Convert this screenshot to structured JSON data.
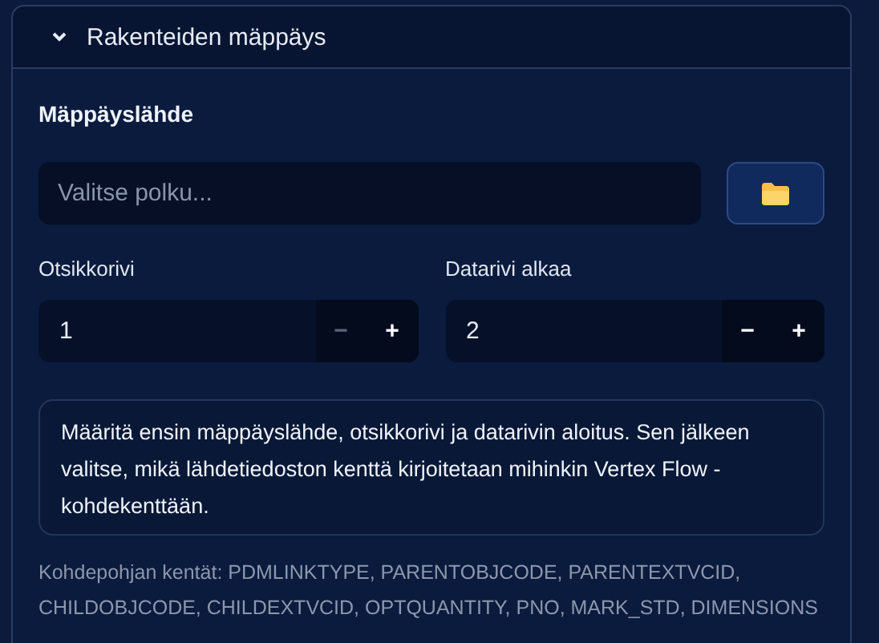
{
  "section": {
    "title": "Rakenteiden mäppäys",
    "expanded": true
  },
  "source": {
    "label": "Mäppäyslähde",
    "placeholder": "Valitse polku..."
  },
  "steppers": [
    {
      "label": "Otsikkorivi",
      "value": "1",
      "minus": "−",
      "plus": "+",
      "minus_disabled": true
    },
    {
      "label": "Datarivi alkaa",
      "value": "2",
      "minus": "−",
      "plus": "+",
      "minus_disabled": false
    }
  ],
  "info": "Määritä ensin mäppäyslähde, otsikkorivi ja datarivin aloitus. Sen jälkeen valitse, mikä lähdetiedoston kenttä kirjoitetaan mihinkin Vertex Flow -kohdekenttään.",
  "target_fields": "Kohdepohjan kentät: PDMLINKTYPE, PARENTOBJCODE, PARENTEXTVCID, CHILDOBJCODE, CHILDEXTVCID, OPTQUANTITY, PNO, MARK_STD, DIMENSIONS"
}
